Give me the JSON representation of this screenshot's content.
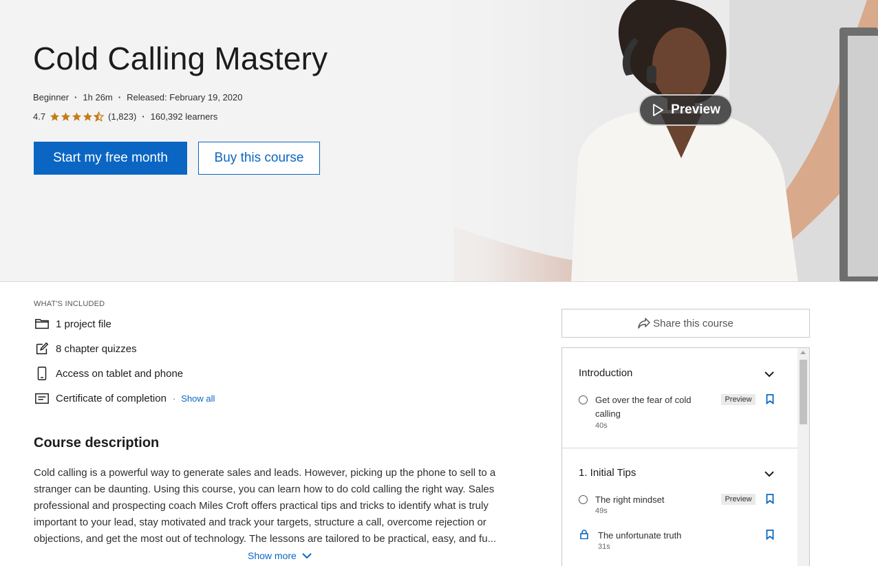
{
  "header": {
    "title": "Cold Calling Mastery",
    "level": "Beginner",
    "duration": "1h 26m",
    "released": "Released: February 19, 2020",
    "rating": "4.7",
    "rating_count": "(1,823)",
    "learners": "160,392 learners",
    "rating_stars": 4.5,
    "star_color": "#c37d16"
  },
  "actions": {
    "primary": "Start my free month",
    "secondary": "Buy this course",
    "preview": "Preview",
    "primary_color": "#0a66c2"
  },
  "included": {
    "heading": "WHAT'S INCLUDED",
    "items": [
      {
        "icon": "folder-icon",
        "label": "1 project file"
      },
      {
        "icon": "quiz-edit-icon",
        "label": "8 chapter quizzes"
      },
      {
        "icon": "phone-icon",
        "label": "Access on tablet and phone"
      },
      {
        "icon": "certificate-icon",
        "label": "Certificate of completion"
      }
    ],
    "show_all": "Show all"
  },
  "description": {
    "title": "Course description",
    "text": "Cold calling is a powerful way to generate sales and leads. However, picking up the phone to sell to a stranger can be daunting. Using this course, you can learn how to do cold calling the right way. Sales professional and prospecting coach Miles Croft offers practical tips and tricks to identify what is truly important to your lead, stay motivated and track your targets, structure a call, overcome rejection or objections, and get the most out of technology. The lessons are tailored to be practical, easy, and fu...",
    "show_more": "Show more"
  },
  "share": {
    "label": "Share this course"
  },
  "toc": {
    "chapters": [
      {
        "title": "Introduction",
        "lessons": [
          {
            "title": "Get over the fear of cold calling",
            "duration": "40s",
            "badge": "Preview",
            "locked": false
          }
        ]
      },
      {
        "title": "1. Initial Tips",
        "lessons": [
          {
            "title": "The right mindset",
            "duration": "49s",
            "badge": "Preview",
            "locked": false
          },
          {
            "title": "The unfortunate truth",
            "duration": "31s",
            "badge": "",
            "locked": true
          }
        ]
      }
    ]
  }
}
